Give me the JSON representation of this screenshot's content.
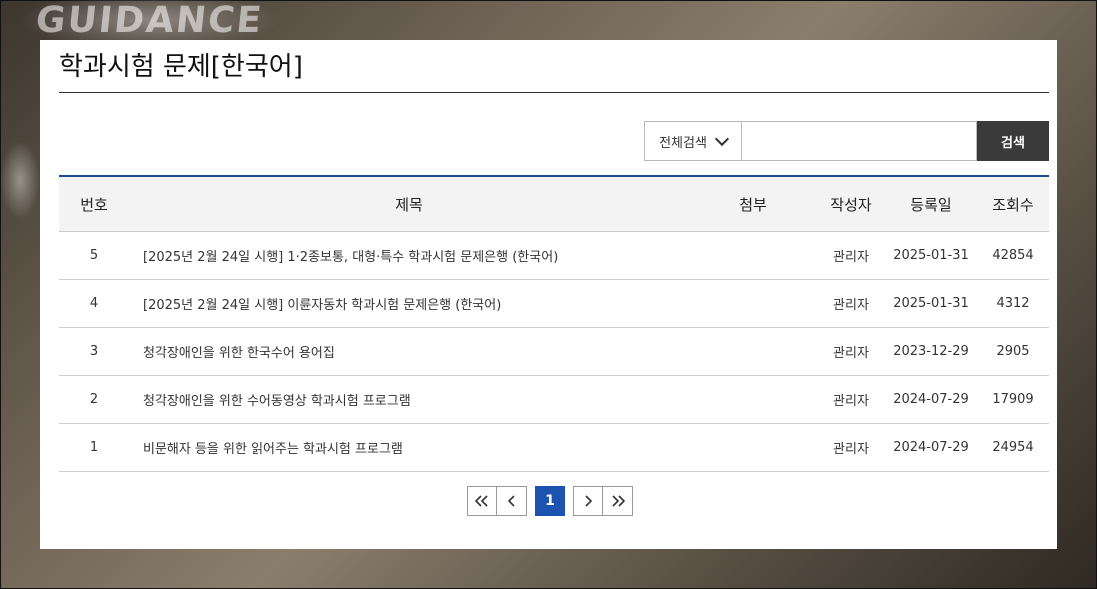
{
  "page": {
    "title": "학과시험 문제[한국어]",
    "background_word": "GUIDANCE"
  },
  "search": {
    "scope_selected": "전체검색",
    "input_value": "",
    "button_label": "검색"
  },
  "table": {
    "headers": {
      "no": "번호",
      "title": "제목",
      "attach": "첨부",
      "author": "작성자",
      "date": "등록일",
      "views": "조회수"
    },
    "rows": [
      {
        "no": "5",
        "title": "[2025년 2월 24일 시행] 1·2종보통, 대형·특수 학과시험 문제은행 (한국어)",
        "attach": "",
        "author": "관리자",
        "date": "2025-01-31",
        "views": "42854"
      },
      {
        "no": "4",
        "title": "[2025년 2월 24일 시행] 이륜자동차 학과시험 문제은행 (한국어)",
        "attach": "",
        "author": "관리자",
        "date": "2025-01-31",
        "views": "4312"
      },
      {
        "no": "3",
        "title": "청각장애인을 위한 한국수어 용어집",
        "attach": "",
        "author": "관리자",
        "date": "2023-12-29",
        "views": "2905"
      },
      {
        "no": "2",
        "title": "청각장애인을 위한 수어동영상 학과시험 프로그램",
        "attach": "",
        "author": "관리자",
        "date": "2024-07-29",
        "views": "17909"
      },
      {
        "no": "1",
        "title": "비문해자 등을 위한 읽어주는 학과시험 프로그램",
        "attach": "",
        "author": "관리자",
        "date": "2024-07-29",
        "views": "24954"
      }
    ]
  },
  "pagination": {
    "current": "1",
    "icons": [
      "double-chevron-left-icon",
      "chevron-left-icon",
      "chevron-right-icon",
      "double-chevron-right-icon"
    ],
    "accent": "#1c52b0"
  },
  "colors": {
    "header_rule": "#1c4a8c",
    "search_button": "#3a3a3a"
  }
}
